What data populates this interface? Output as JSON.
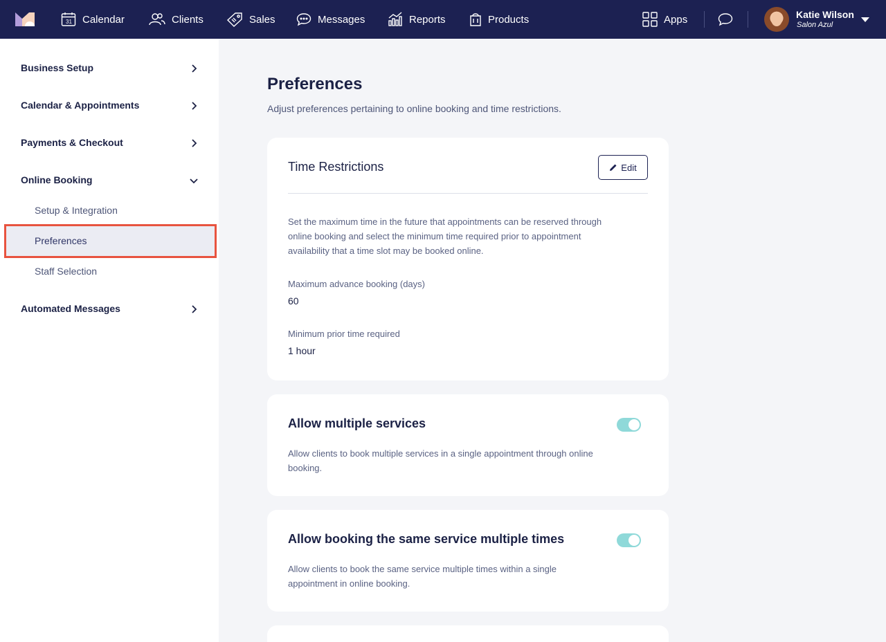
{
  "nav": {
    "items": [
      {
        "label": "Calendar",
        "icon": "calendar-icon"
      },
      {
        "label": "Clients",
        "icon": "clients-icon"
      },
      {
        "label": "Sales",
        "icon": "tag-icon"
      },
      {
        "label": "Messages",
        "icon": "chat-icon"
      },
      {
        "label": "Reports",
        "icon": "bar-chart-icon"
      },
      {
        "label": "Products",
        "icon": "bag-icon"
      }
    ],
    "apps_label": "Apps",
    "calendar_day": "31",
    "user": {
      "name": "Katie Wilson",
      "org": "Salon Azul"
    }
  },
  "sidebar": {
    "sections": [
      {
        "label": "Business Setup",
        "expanded": false
      },
      {
        "label": "Calendar & Appointments",
        "expanded": false
      },
      {
        "label": "Payments & Checkout",
        "expanded": false
      },
      {
        "label": "Online Booking",
        "expanded": true
      },
      {
        "label": "Automated Messages",
        "expanded": false
      }
    ],
    "online_booking_items": [
      {
        "label": "Setup & Integration",
        "active": false
      },
      {
        "label": "Preferences",
        "active": true
      },
      {
        "label": "Staff Selection",
        "active": false
      }
    ]
  },
  "main": {
    "title": "Preferences",
    "subtitle": "Adjust preferences pertaining to online booking and time restrictions.",
    "time_restrictions": {
      "title": "Time Restrictions",
      "edit_label": "Edit",
      "description": "Set the maximum time in the future that appointments can be reserved through online booking and select the minimum time required prior to appointment availability that a time slot may be booked online.",
      "max_advance_label": "Maximum advance booking (days)",
      "max_advance_value": "60",
      "min_prior_label": "Minimum prior time required",
      "min_prior_value": "1 hour"
    },
    "multiple_services": {
      "title": "Allow multiple services",
      "description": "Allow clients to book multiple services in a single appointment through online booking.",
      "enabled": true
    },
    "same_service": {
      "title": "Allow booking the same service multiple times",
      "description": "Allow clients to book the same service multiple times within a single appointment in online booking.",
      "enabled": true
    }
  },
  "colors": {
    "nav_bg": "#1c2152",
    "toggle_on": "#8fd9d9",
    "highlight": "#e8533f",
    "page_bg": "#f4f5f8"
  }
}
